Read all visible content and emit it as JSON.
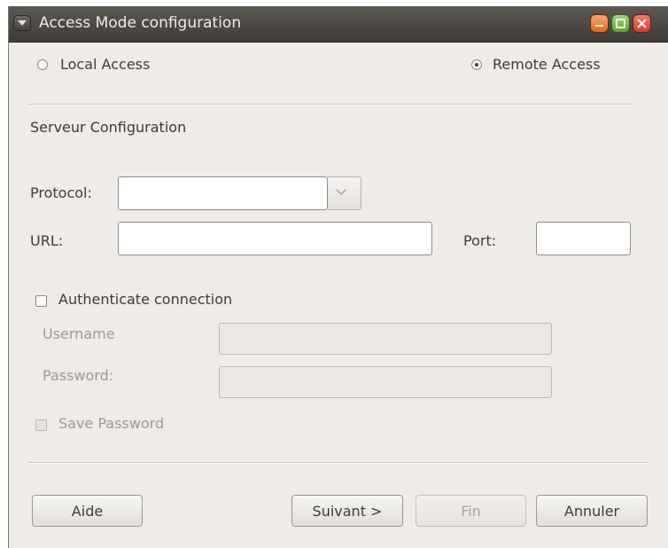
{
  "window": {
    "title": "Access Mode configuration"
  },
  "access_mode": {
    "local_label": "Local Access",
    "remote_label": "Remote Access",
    "selected": "Remote Access"
  },
  "server": {
    "section_title": "Serveur Configuration",
    "protocol_label": "Protocol:",
    "protocol_value": "",
    "url_label": "URL:",
    "url_value": "",
    "port_label": "Port:",
    "port_value": ""
  },
  "auth": {
    "checkbox_label": "Authenticate connection",
    "checked": false,
    "username_label": "Username",
    "username_value": "",
    "password_label": "Password:",
    "password_value": "",
    "save_password_label": "Save Password",
    "save_password_checked": false
  },
  "buttons": {
    "help": "Aide",
    "next": "Suivant >",
    "finish": "Fin",
    "cancel": "Annuler"
  },
  "colors": {
    "titlebar": "#3e3c38",
    "window_bg": "#efebe7",
    "minimize": "#e3691f",
    "maximize": "#5fa431",
    "close": "#d23a22"
  }
}
